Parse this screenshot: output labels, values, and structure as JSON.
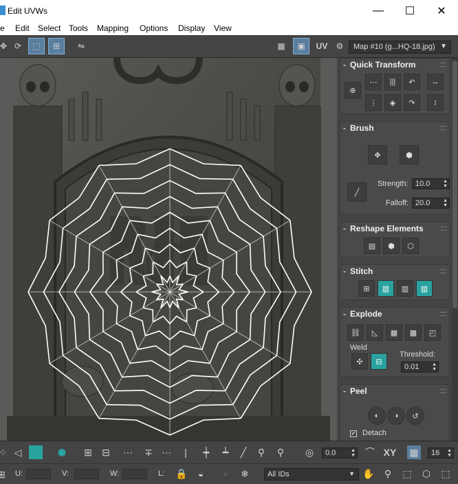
{
  "window": {
    "title": "Edit UVWs",
    "minimize": "—",
    "maximize": "☐",
    "close": "✕"
  },
  "menu": {
    "items": [
      "e",
      "Edit",
      "Select",
      "Tools",
      "Mapping",
      "Options",
      "Display",
      "View"
    ]
  },
  "toolbar": {
    "uv_label": "UV",
    "map_select": "Map #10 (g...HQ-18.jpg)"
  },
  "panel": {
    "quick_transform": "Quick Transform",
    "brush": "Brush",
    "strength_label": "Strength:",
    "strength_value": "10.0",
    "falloff_label": "Falloff:",
    "falloff_value": "20.0",
    "reshape": "Reshape Elements",
    "stitch": "Stitch",
    "explode": "Explode",
    "weld": "Weld",
    "threshold_label": "Threshold:",
    "threshold_value": "0.01",
    "peel": "Peel",
    "detach_label": "Detach",
    "detach_checked": "✔"
  },
  "bottom": {
    "angle_value": "0.0",
    "xy_label": "XY",
    "grid_value": "16",
    "u_label": "U:",
    "v_label": "V:",
    "w_label": "W:",
    "l_label": "L:",
    "ids_select": "All IDs"
  },
  "colors": {
    "accent": "#2aa3a0",
    "active": "#5a7e9e",
    "panel": "#444444",
    "uv_lines": "#ffffff"
  }
}
